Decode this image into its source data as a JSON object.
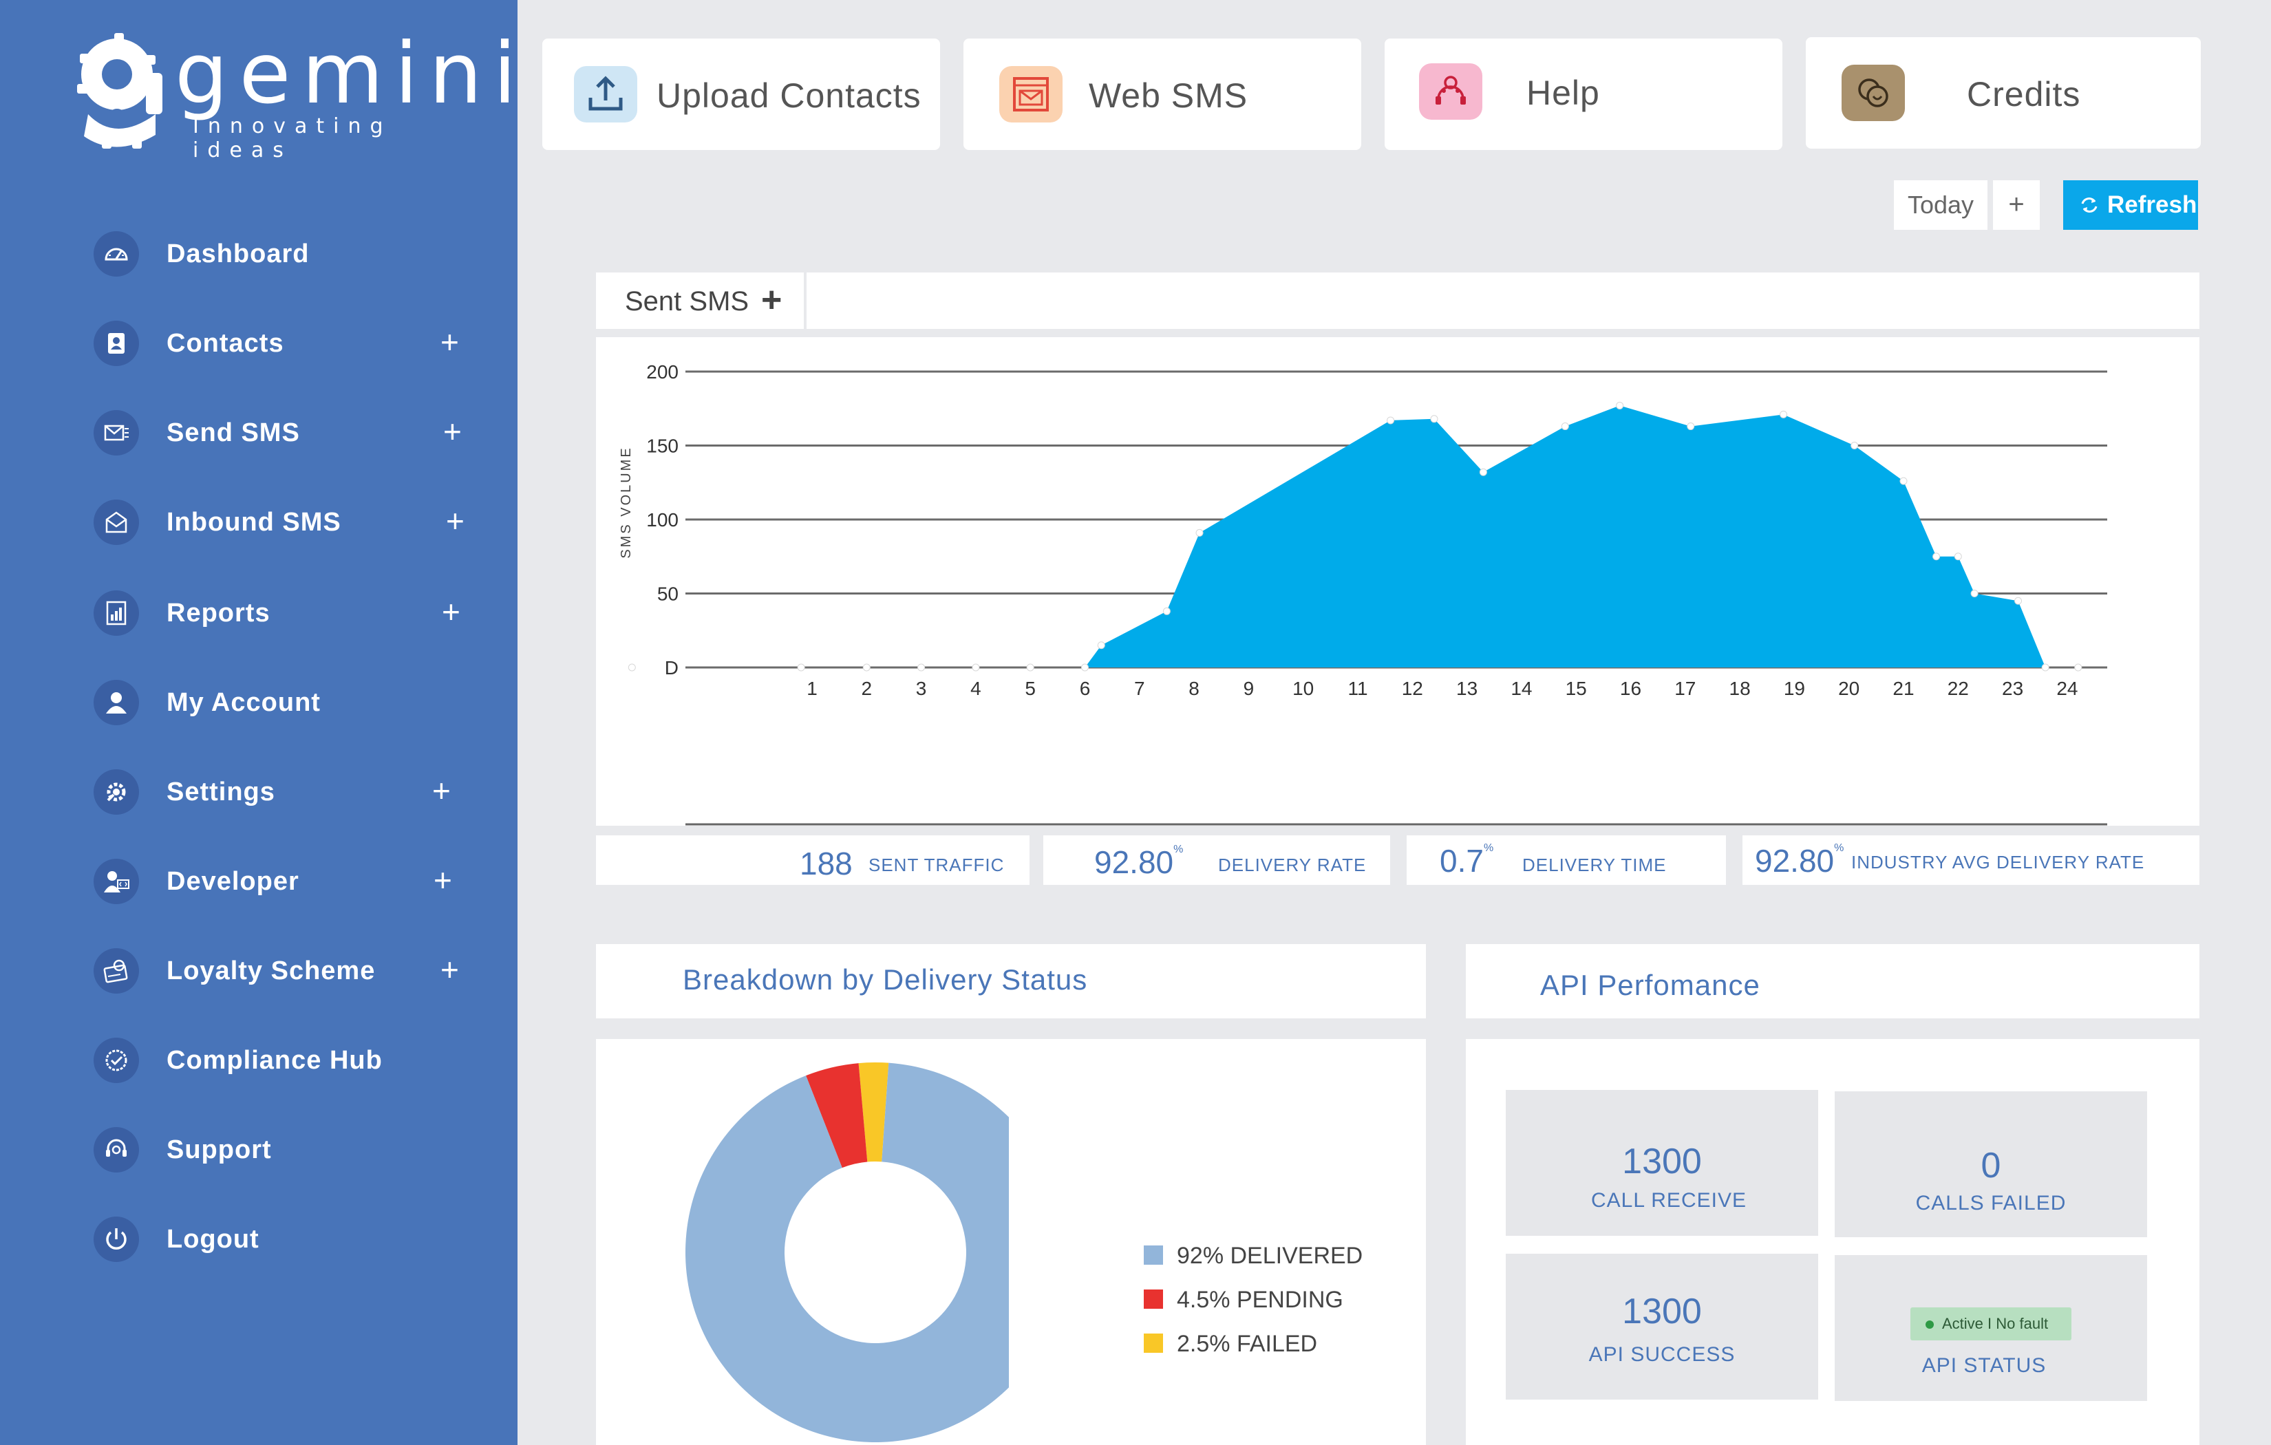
{
  "brand": {
    "name": "gemini",
    "tagline": "Innovating ideas"
  },
  "sidebar": {
    "items": [
      {
        "label": "Dashboard",
        "icon": "dashboard-gauge-icon",
        "expandable": false
      },
      {
        "label": "Contacts",
        "icon": "contact-card-icon",
        "expandable": true
      },
      {
        "label": "Send SMS",
        "icon": "send-mail-icon",
        "expandable": true
      },
      {
        "label": "Inbound SMS",
        "icon": "inbound-mail-icon",
        "expandable": true
      },
      {
        "label": "Reports",
        "icon": "report-icon",
        "expandable": true
      },
      {
        "label": "My Account",
        "icon": "user-icon",
        "expandable": false
      },
      {
        "label": "Settings",
        "icon": "settings-gear-icon",
        "expandable": true
      },
      {
        "label": "Developer",
        "icon": "developer-icon",
        "expandable": true
      },
      {
        "label": "Loyalty Scheme",
        "icon": "loyalty-icon",
        "expandable": true
      },
      {
        "label": "Compliance Hub",
        "icon": "compliance-badge-icon",
        "expandable": false
      },
      {
        "label": "Support",
        "icon": "support-headset-icon",
        "expandable": false
      },
      {
        "label": "Logout",
        "icon": "power-icon",
        "expandable": false
      }
    ],
    "plus_symbol": "+"
  },
  "quick_actions": [
    {
      "label": "Upload Contacts",
      "icon": "upload-icon",
      "icon_bg": "#cfe6f5"
    },
    {
      "label": "Web SMS",
      "icon": "web-window-icon",
      "icon_bg": "#fbd2b0"
    },
    {
      "label": "Help",
      "icon": "help-support-icon",
      "icon_bg": "#f7b8cf"
    },
    {
      "label": "Credits",
      "icon": "coins-icon",
      "icon_bg": "#a9916d"
    }
  ],
  "toolbar": {
    "today_label": "Today",
    "plus_label": "+",
    "refresh_label": "Refresh"
  },
  "chart_tab": {
    "label": "Sent SMS",
    "plus": "+"
  },
  "chart_data": {
    "type": "area",
    "ylabel": "SMS VOLUME",
    "xlabel": "",
    "ylim": [
      0,
      200
    ],
    "y_ticks": [
      "D",
      "50",
      "100",
      "150",
      "200"
    ],
    "x_ticks": [
      "1",
      "2",
      "3",
      "4",
      "5",
      "6",
      "7",
      "8",
      "9",
      "10",
      "11",
      "12",
      "13",
      "14",
      "15",
      "16",
      "17",
      "18",
      "19",
      "20",
      "21",
      "22",
      "23",
      "24"
    ],
    "xlim": [
      -2.3,
      24.2
    ],
    "color": "#00abea",
    "points": [
      [
        -2.3,
        0
      ],
      [
        0.8,
        0
      ],
      [
        2,
        0
      ],
      [
        3,
        0
      ],
      [
        4,
        0
      ],
      [
        5,
        0
      ],
      [
        6,
        0
      ],
      [
        6.3,
        15
      ],
      [
        7.5,
        38
      ],
      [
        8.1,
        91
      ],
      [
        11.6,
        167
      ],
      [
        12.4,
        168
      ],
      [
        13.3,
        132
      ],
      [
        14.8,
        163
      ],
      [
        15.8,
        177
      ],
      [
        17.1,
        163
      ],
      [
        18.8,
        171
      ],
      [
        20.1,
        150
      ],
      [
        21,
        126
      ],
      [
        21.6,
        75
      ],
      [
        22,
        75
      ],
      [
        22.3,
        50
      ],
      [
        23.1,
        45
      ],
      [
        23.6,
        0
      ],
      [
        24.2,
        0
      ]
    ],
    "grid": true
  },
  "stats": [
    {
      "value": "188",
      "sup": "",
      "label": "SENT TRAFFIC"
    },
    {
      "value": "92.80",
      "sup": "%",
      "label": "DELIVERY RATE"
    },
    {
      "value": "0.7",
      "sup": "%",
      "label": "DELIVERY TIME"
    },
    {
      "value": "92.80",
      "sup": "%",
      "label": "INDUSTRY AVG DELIVERY RATE"
    }
  ],
  "breakdown": {
    "title": "Breakdown by Delivery Status",
    "chart_data": {
      "type": "pie",
      "donut": true,
      "slices": [
        {
          "label": "92% DELIVERED",
          "value": 92,
          "color": "#92b5da"
        },
        {
          "label": "4.5% PENDING",
          "value": 4.5,
          "color": "#e8322f"
        },
        {
          "label": "2.5% FAILED",
          "value": 2.5,
          "color": "#f9c727"
        }
      ]
    }
  },
  "api": {
    "title": "API Perfomance",
    "boxes": [
      {
        "value": "1300",
        "label": "CALL RECEIVE"
      },
      {
        "value": "0",
        "label": "CALLS FAILED"
      },
      {
        "value": "1300",
        "label": "API SUCCESS"
      },
      {
        "value": "",
        "badge": "Active I No fault",
        "label": "API STATUS"
      }
    ]
  }
}
